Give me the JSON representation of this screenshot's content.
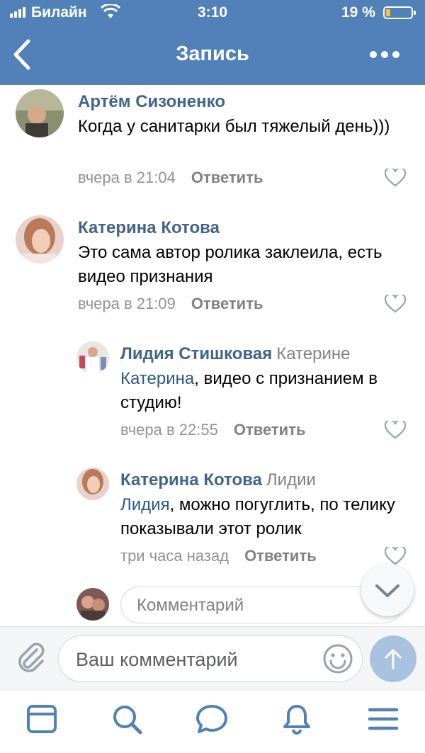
{
  "status_bar": {
    "carrier": "Билайн",
    "time": "3:10",
    "battery_percent": "19 %",
    "battery_level": 0.19
  },
  "header": {
    "title": "Запись",
    "back_icon": "chevron-left-icon",
    "more_icon": "ellipsis-icon"
  },
  "comments": [
    {
      "author": "Артём Сизоненко",
      "reply_to": "",
      "mention": "",
      "text": "Когда у санитарки был тяжелый день)))",
      "time": "вчера в 21:04",
      "reply_label": "Ответить"
    },
    {
      "author": "Катерина Котова",
      "reply_to": "",
      "mention": "",
      "text": "Это сама автор ролика заклеила, есть видео признания",
      "time": "вчера в 21:09",
      "reply_label": "Ответить"
    },
    {
      "author": "Лидия Стишковая",
      "reply_to": "Катерине",
      "mention": "Катерина",
      "text": ", видео с признанием в студию!",
      "time": "вчера в 22:55",
      "reply_label": "Ответить"
    },
    {
      "author": "Катерина Котова",
      "reply_to": "Лидии",
      "mention": "Лидия",
      "text": ", можно погуглить, по телику показывали этот ролик",
      "time": "три часа назад",
      "reply_label": "Ответить"
    }
  ],
  "inline_compose": {
    "placeholder": "Комментарий"
  },
  "input_bar": {
    "placeholder": "Ваш комментарий"
  },
  "tabbar": {
    "icons": [
      "news-icon",
      "search-icon",
      "messages-icon",
      "notifications-icon",
      "menu-icon"
    ]
  },
  "colors": {
    "header_bg": "#5181b8",
    "author": "#42648b",
    "mention": "#2a5885",
    "meta": "#939393",
    "tab_icon": "#5181b8"
  }
}
